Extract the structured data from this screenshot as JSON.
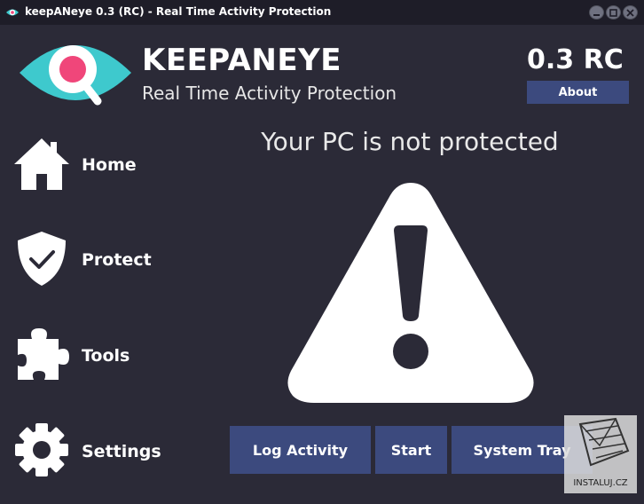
{
  "titlebar": {
    "title": "keepANeye 0.3 (RC) - Real Time Activity Protection"
  },
  "header": {
    "brand": "KEEPANEYE",
    "tagline": "Real Time Activity Protection",
    "version": "0.3 RC",
    "about_label": "About"
  },
  "sidebar": {
    "items": [
      {
        "label": "Home",
        "icon": "home-icon"
      },
      {
        "label": "Protect",
        "icon": "shield-check-icon"
      },
      {
        "label": "Tools",
        "icon": "puzzle-icon"
      },
      {
        "label": "Settings",
        "icon": "gear-icon"
      }
    ]
  },
  "main": {
    "status": "Your PC is not protected",
    "status_icon": "warning-icon"
  },
  "actions": {
    "log_label": "Log Activity",
    "start_label": "Start",
    "tray_label": "System Tray"
  },
  "watermark": {
    "text": "INSTALUJ.CZ"
  },
  "colors": {
    "background": "#2b2a37",
    "titlebar": "#1e1d28",
    "button": "#3c4a7e",
    "logo_teal": "#3ec9cd",
    "logo_pink": "#f0467a"
  }
}
